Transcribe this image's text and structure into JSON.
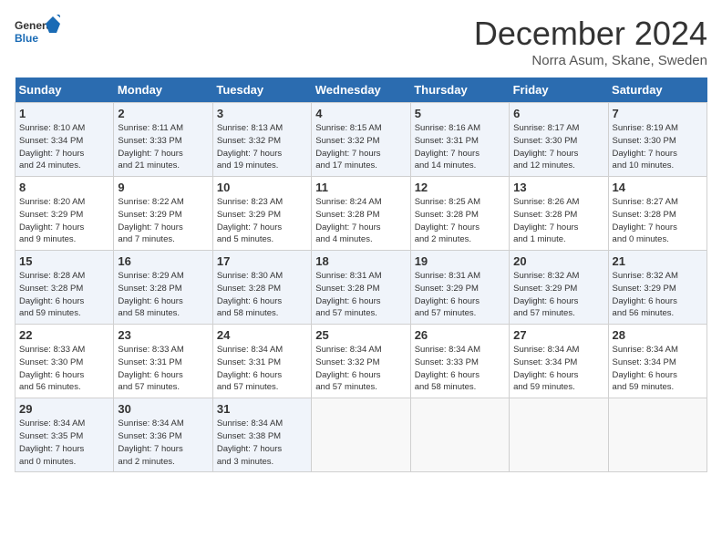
{
  "logo": {
    "line1": "General",
    "line2": "Blue"
  },
  "title": "December 2024",
  "location": "Norra Asum, Skane, Sweden",
  "days_of_week": [
    "Sunday",
    "Monday",
    "Tuesday",
    "Wednesday",
    "Thursday",
    "Friday",
    "Saturday"
  ],
  "weeks": [
    [
      {
        "day": "1",
        "detail": "Sunrise: 8:10 AM\nSunset: 3:34 PM\nDaylight: 7 hours\nand 24 minutes."
      },
      {
        "day": "2",
        "detail": "Sunrise: 8:11 AM\nSunset: 3:33 PM\nDaylight: 7 hours\nand 21 minutes."
      },
      {
        "day": "3",
        "detail": "Sunrise: 8:13 AM\nSunset: 3:32 PM\nDaylight: 7 hours\nand 19 minutes."
      },
      {
        "day": "4",
        "detail": "Sunrise: 8:15 AM\nSunset: 3:32 PM\nDaylight: 7 hours\nand 17 minutes."
      },
      {
        "day": "5",
        "detail": "Sunrise: 8:16 AM\nSunset: 3:31 PM\nDaylight: 7 hours\nand 14 minutes."
      },
      {
        "day": "6",
        "detail": "Sunrise: 8:17 AM\nSunset: 3:30 PM\nDaylight: 7 hours\nand 12 minutes."
      },
      {
        "day": "7",
        "detail": "Sunrise: 8:19 AM\nSunset: 3:30 PM\nDaylight: 7 hours\nand 10 minutes."
      }
    ],
    [
      {
        "day": "8",
        "detail": "Sunrise: 8:20 AM\nSunset: 3:29 PM\nDaylight: 7 hours\nand 9 minutes."
      },
      {
        "day": "9",
        "detail": "Sunrise: 8:22 AM\nSunset: 3:29 PM\nDaylight: 7 hours\nand 7 minutes."
      },
      {
        "day": "10",
        "detail": "Sunrise: 8:23 AM\nSunset: 3:29 PM\nDaylight: 7 hours\nand 5 minutes."
      },
      {
        "day": "11",
        "detail": "Sunrise: 8:24 AM\nSunset: 3:28 PM\nDaylight: 7 hours\nand 4 minutes."
      },
      {
        "day": "12",
        "detail": "Sunrise: 8:25 AM\nSunset: 3:28 PM\nDaylight: 7 hours\nand 2 minutes."
      },
      {
        "day": "13",
        "detail": "Sunrise: 8:26 AM\nSunset: 3:28 PM\nDaylight: 7 hours\nand 1 minute."
      },
      {
        "day": "14",
        "detail": "Sunrise: 8:27 AM\nSunset: 3:28 PM\nDaylight: 7 hours\nand 0 minutes."
      }
    ],
    [
      {
        "day": "15",
        "detail": "Sunrise: 8:28 AM\nSunset: 3:28 PM\nDaylight: 6 hours\nand 59 minutes."
      },
      {
        "day": "16",
        "detail": "Sunrise: 8:29 AM\nSunset: 3:28 PM\nDaylight: 6 hours\nand 58 minutes."
      },
      {
        "day": "17",
        "detail": "Sunrise: 8:30 AM\nSunset: 3:28 PM\nDaylight: 6 hours\nand 58 minutes."
      },
      {
        "day": "18",
        "detail": "Sunrise: 8:31 AM\nSunset: 3:28 PM\nDaylight: 6 hours\nand 57 minutes."
      },
      {
        "day": "19",
        "detail": "Sunrise: 8:31 AM\nSunset: 3:29 PM\nDaylight: 6 hours\nand 57 minutes."
      },
      {
        "day": "20",
        "detail": "Sunrise: 8:32 AM\nSunset: 3:29 PM\nDaylight: 6 hours\nand 57 minutes."
      },
      {
        "day": "21",
        "detail": "Sunrise: 8:32 AM\nSunset: 3:29 PM\nDaylight: 6 hours\nand 56 minutes."
      }
    ],
    [
      {
        "day": "22",
        "detail": "Sunrise: 8:33 AM\nSunset: 3:30 PM\nDaylight: 6 hours\nand 56 minutes."
      },
      {
        "day": "23",
        "detail": "Sunrise: 8:33 AM\nSunset: 3:31 PM\nDaylight: 6 hours\nand 57 minutes."
      },
      {
        "day": "24",
        "detail": "Sunrise: 8:34 AM\nSunset: 3:31 PM\nDaylight: 6 hours\nand 57 minutes."
      },
      {
        "day": "25",
        "detail": "Sunrise: 8:34 AM\nSunset: 3:32 PM\nDaylight: 6 hours\nand 57 minutes."
      },
      {
        "day": "26",
        "detail": "Sunrise: 8:34 AM\nSunset: 3:33 PM\nDaylight: 6 hours\nand 58 minutes."
      },
      {
        "day": "27",
        "detail": "Sunrise: 8:34 AM\nSunset: 3:34 PM\nDaylight: 6 hours\nand 59 minutes."
      },
      {
        "day": "28",
        "detail": "Sunrise: 8:34 AM\nSunset: 3:34 PM\nDaylight: 6 hours\nand 59 minutes."
      }
    ],
    [
      {
        "day": "29",
        "detail": "Sunrise: 8:34 AM\nSunset: 3:35 PM\nDaylight: 7 hours\nand 0 minutes."
      },
      {
        "day": "30",
        "detail": "Sunrise: 8:34 AM\nSunset: 3:36 PM\nDaylight: 7 hours\nand 2 minutes."
      },
      {
        "day": "31",
        "detail": "Sunrise: 8:34 AM\nSunset: 3:38 PM\nDaylight: 7 hours\nand 3 minutes."
      },
      {
        "day": "",
        "detail": ""
      },
      {
        "day": "",
        "detail": ""
      },
      {
        "day": "",
        "detail": ""
      },
      {
        "day": "",
        "detail": ""
      }
    ]
  ]
}
